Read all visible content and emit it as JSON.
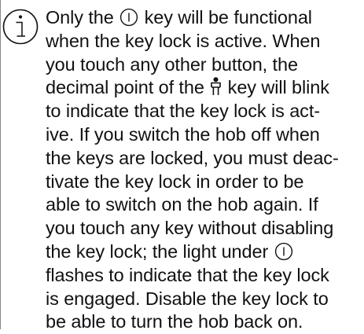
{
  "note": {
    "line_1_prefix": "Only the",
    "line_1_suffix": "key will be functional",
    "line_2": "when the key lock is active. When",
    "line_3": "you touch any other button, the",
    "line_4_prefix": "decimal point of the",
    "line_4_suffix": "key will blink",
    "line_5": "to indicate that the key lock is act-",
    "line_6": "ive. If you switch the hob off when",
    "line_7": "the keys are locked, you must deac-",
    "line_8": "tivate the key lock in order to be",
    "line_9": "able to switch on the hob again. If",
    "line_10": "you touch any key without disabling",
    "line_11_prefix": "the key lock; the light under",
    "line_12": "flashes to indicate that the key lock",
    "line_13": "is engaged. Disable the key lock to",
    "line_14": "be able to turn the hob back on."
  },
  "icons": {
    "info": "info-icon",
    "power_key": "power-key-icon",
    "lock_key": "key-lock-icon"
  }
}
